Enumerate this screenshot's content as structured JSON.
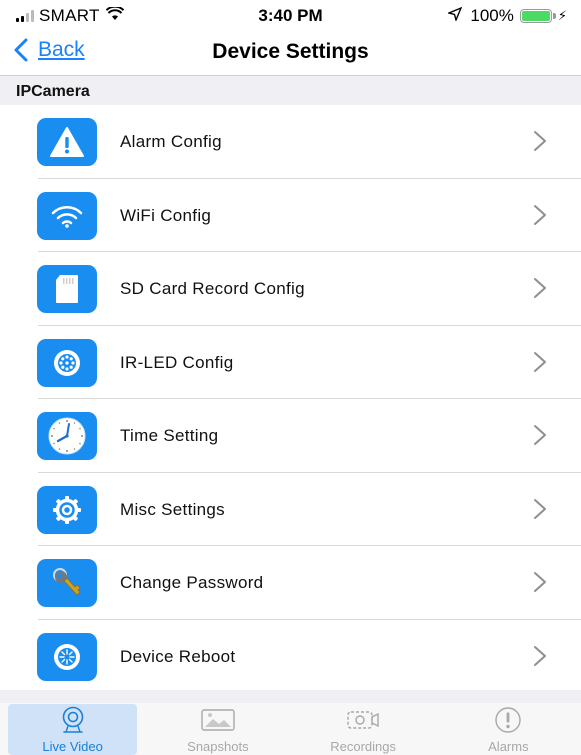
{
  "status_bar": {
    "carrier": "SMART",
    "time": "3:40 PM",
    "battery": "100%",
    "battery_level": 1.0
  },
  "nav": {
    "back_label": "Back",
    "title": "Device Settings"
  },
  "section": {
    "title": "IPCamera"
  },
  "settings": [
    {
      "label": "Alarm Config",
      "icon": "alarm-warning-icon"
    },
    {
      "label": "WiFi Config",
      "icon": "wifi-icon"
    },
    {
      "label": "SD Card Record Config",
      "icon": "sd-card-icon"
    },
    {
      "label": "IR-LED Config",
      "icon": "ir-led-icon"
    },
    {
      "label": "Time Setting",
      "icon": "clock-icon"
    },
    {
      "label": "Misc Settings",
      "icon": "gear-icon"
    },
    {
      "label": "Change Password",
      "icon": "key-icon"
    },
    {
      "label": "Device Reboot",
      "icon": "reboot-icon"
    }
  ],
  "tabs": [
    {
      "label": "Live Video",
      "icon": "live-video-icon",
      "active": true
    },
    {
      "label": "Snapshots",
      "icon": "snapshots-icon",
      "active": false
    },
    {
      "label": "Recordings",
      "icon": "recordings-icon",
      "active": false
    },
    {
      "label": "Alarms",
      "icon": "alarms-icon",
      "active": false
    }
  ],
  "colors": {
    "accent": "#1a82fb",
    "icon_tile": "#1a8ef0",
    "active_tab_bg": "#cfe2f7",
    "battery": "#4cd964"
  }
}
